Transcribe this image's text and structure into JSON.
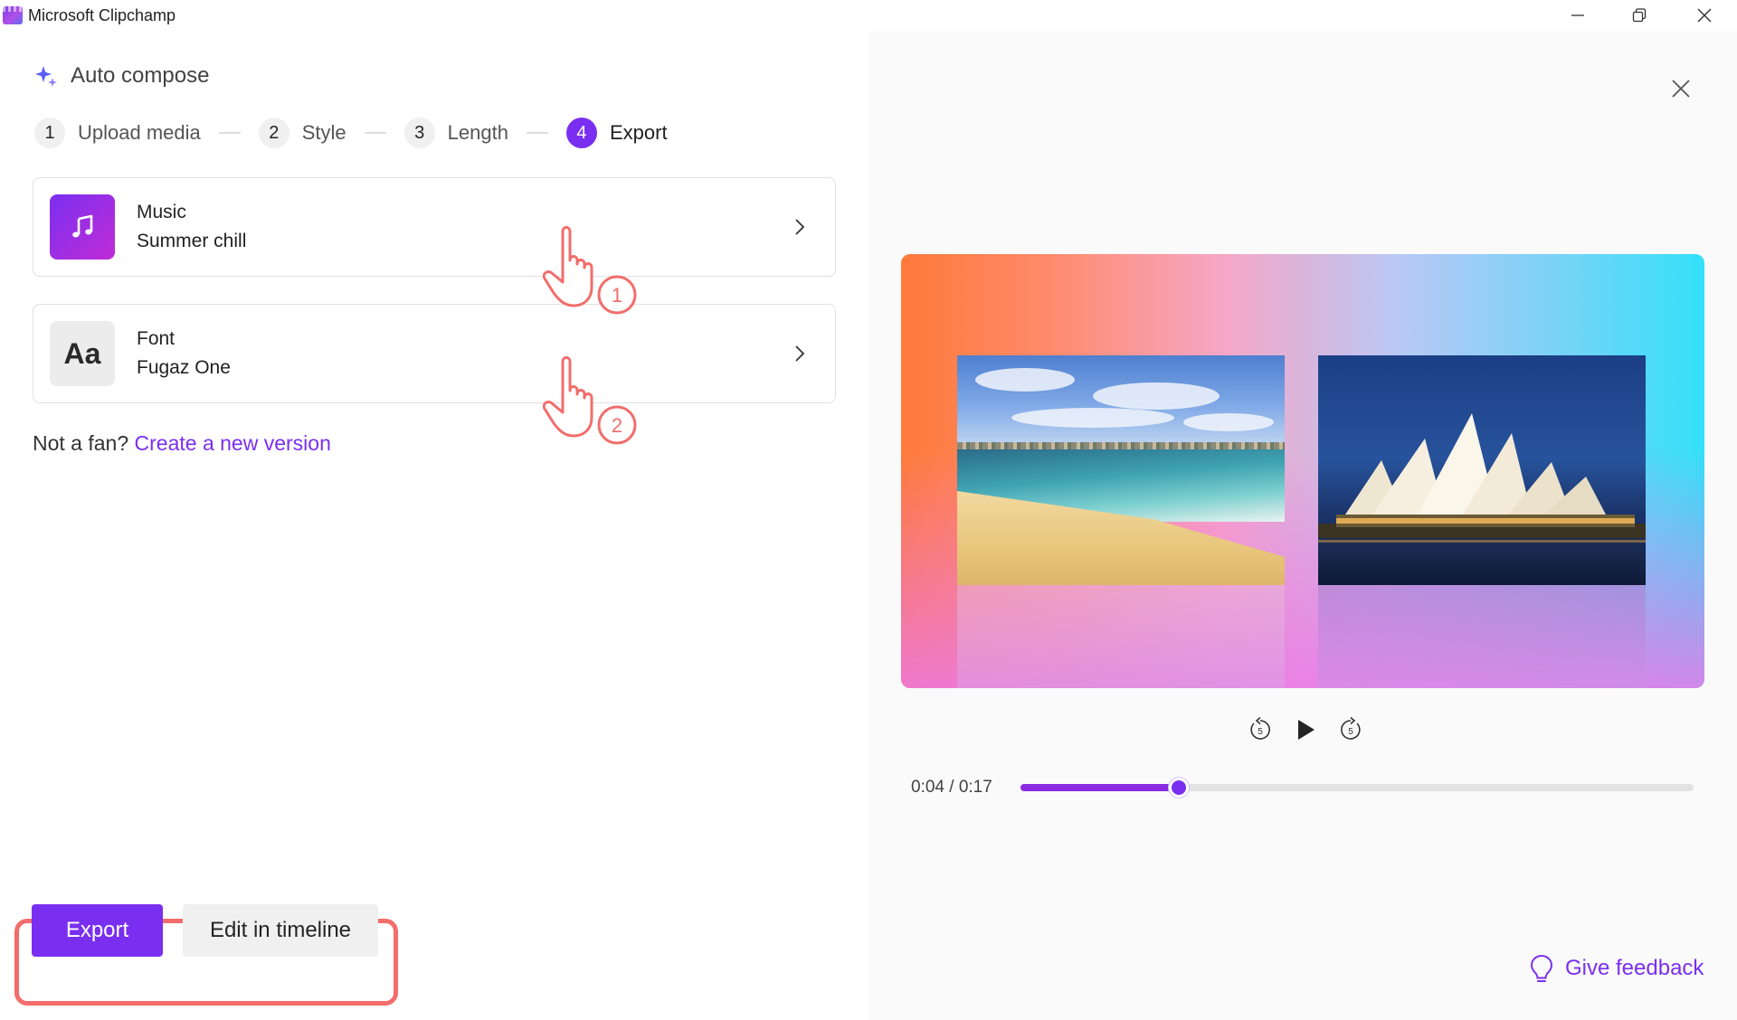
{
  "window": {
    "title": "Microsoft Clipchamp"
  },
  "header": {
    "title": "Auto compose"
  },
  "steps": [
    {
      "number": "1",
      "label": "Upload media",
      "active": false
    },
    {
      "number": "2",
      "label": "Style",
      "active": false
    },
    {
      "number": "3",
      "label": "Length",
      "active": false
    },
    {
      "number": "4",
      "label": "Export",
      "active": true
    }
  ],
  "cards": {
    "music": {
      "title": "Music",
      "value": "Summer chill",
      "icon": "music-note-icon"
    },
    "font": {
      "title": "Font",
      "value": "Fugaz One",
      "icon_text": "Aa"
    }
  },
  "annotations": {
    "callout_1": "1",
    "callout_2": "2"
  },
  "regenerate": {
    "prompt": "Not a fan?",
    "link": "Create a new version"
  },
  "actions": {
    "export_label": "Export",
    "edit_label": "Edit in timeline"
  },
  "player": {
    "current_time": "0:04",
    "separator": "/",
    "duration": "0:17",
    "progress": 0.235,
    "rewind_seconds": "5",
    "forward_seconds": "5"
  },
  "feedback": {
    "label": "Give feedback"
  },
  "colors": {
    "accent": "#7a2ff0",
    "callout": "#f26d6b"
  }
}
